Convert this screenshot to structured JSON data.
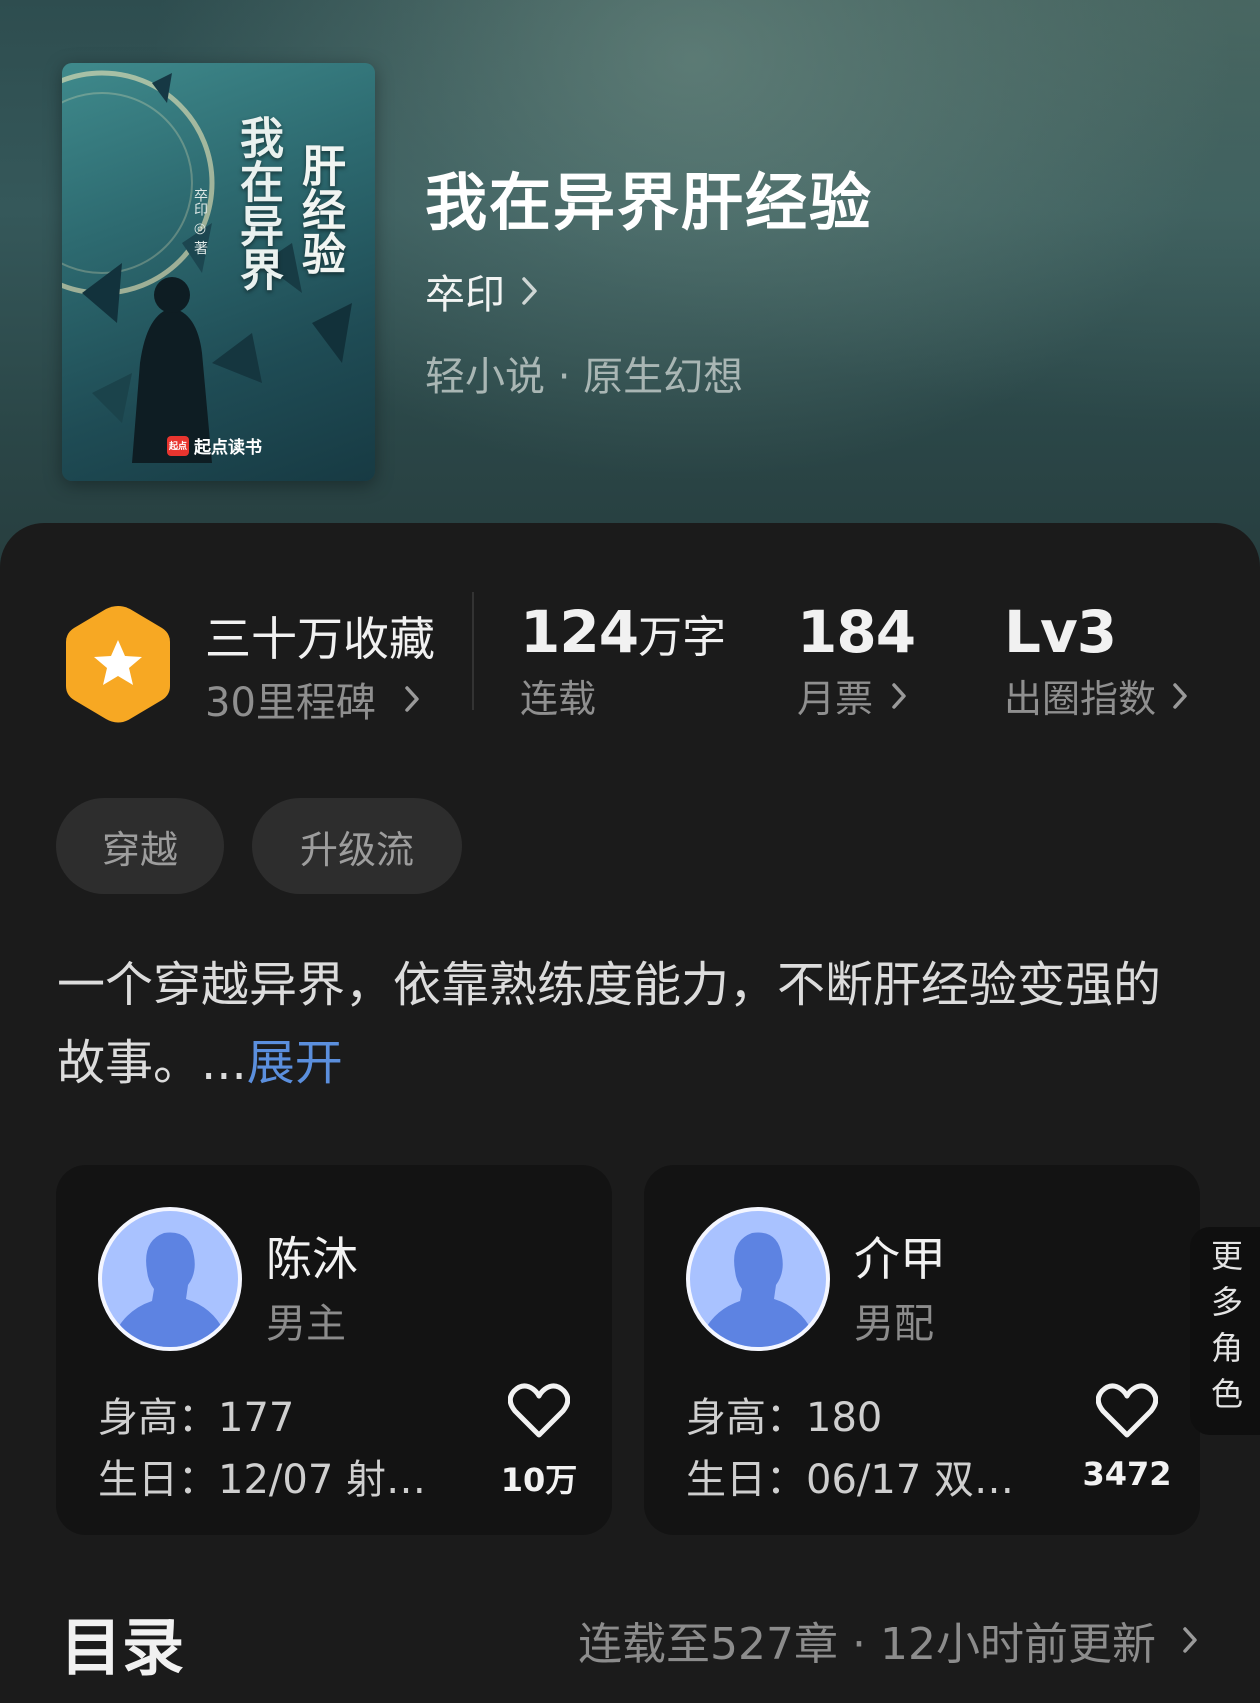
{
  "book": {
    "title": "我在异界肝经验",
    "author": "卒印",
    "genre": "轻小说 · 原生幻想",
    "cover": {
      "title_line1": "我在异界",
      "title_line2": "肝经验",
      "author": "卒印 ◎ 著",
      "publisher": "起点读书",
      "publisher_badge": "起点"
    }
  },
  "stats": {
    "collection": {
      "title": "三十万收藏",
      "subtitle": "30里程碑",
      "icon": "star-hexagon-icon"
    },
    "words": {
      "value": "124",
      "unit": "万字",
      "label": "连载"
    },
    "monthly_votes": {
      "value": "184",
      "label": "月票"
    },
    "popularity": {
      "value": "Lv3",
      "label": "出圈指数"
    }
  },
  "tags": [
    "穿越",
    "升级流"
  ],
  "description": {
    "text": "一个穿越异界，依靠熟练度能力，不断肝经验变强的故事。...",
    "expand_label": "展开"
  },
  "characters": [
    {
      "name": "陈沐",
      "role": "男主",
      "height": "身高：177",
      "birthday": "生日：12/07 射…",
      "likes": "10万"
    },
    {
      "name": "介甲",
      "role": "男配",
      "height": "身高：180",
      "birthday": "生日：06/17 双…",
      "likes": "3472"
    }
  ],
  "more_roles_label": "更多角色",
  "toc": {
    "title": "目录",
    "status": "连载至527章 · 12小时前更新"
  },
  "colors": {
    "accent_link": "#5b8fdd",
    "badge_orange": "#f7a823",
    "avatar_blue": "#a9c2ff"
  }
}
